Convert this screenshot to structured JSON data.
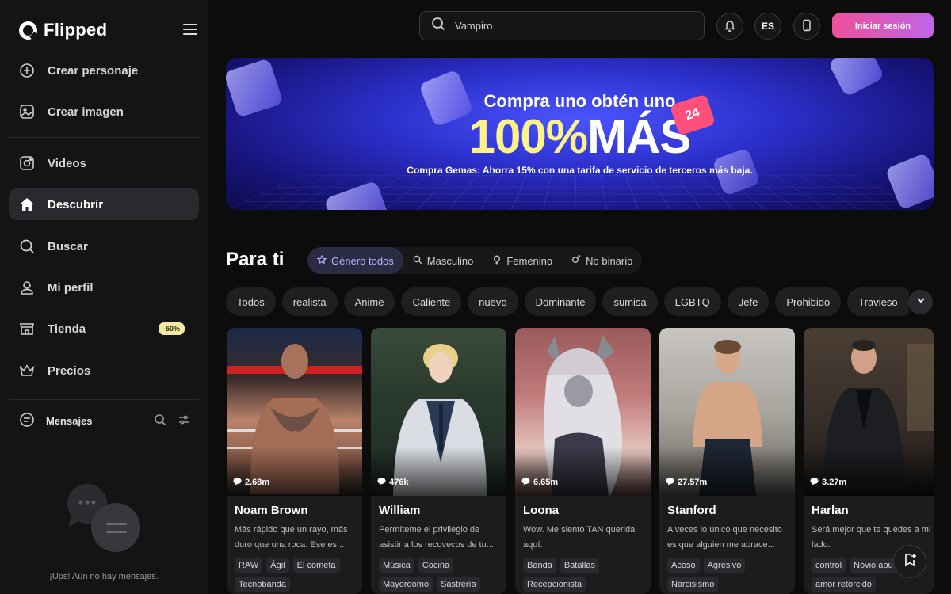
{
  "app": {
    "name": "Flipped"
  },
  "sidebar": {
    "items": [
      {
        "label": "Crear personaje",
        "icon": "plus-square-icon"
      },
      {
        "label": "Crear imagen",
        "icon": "image-icon"
      },
      {
        "label": "Videos",
        "icon": "video-icon"
      },
      {
        "label": "Descubrir",
        "icon": "home-icon",
        "active": true
      },
      {
        "label": "Buscar",
        "icon": "search-icon"
      },
      {
        "label": "Mi perfil",
        "icon": "user-icon"
      },
      {
        "label": "Tienda",
        "icon": "store-icon",
        "badge": "-50%"
      },
      {
        "label": "Precios",
        "icon": "crown-icon"
      }
    ],
    "messages": {
      "title": "Mensajes",
      "empty": "¡Ups! Aún no hay mensajes."
    }
  },
  "header": {
    "search_value": "Vampiro",
    "language": "ES",
    "login_label": "Iniciar sesión"
  },
  "banner": {
    "line1": "Compra uno obtén uno",
    "percent": "100%",
    "mas": "MÁS",
    "badge": "24",
    "line3": "Compra Gemas: Ahorra 15% con una tarifa de servicio de terceros más baja."
  },
  "feed": {
    "title": "Para ti",
    "genders": [
      "Género todos",
      "Masculino",
      "Femenino",
      "No binario"
    ],
    "chips": [
      "Todos",
      "realista",
      "Anime",
      "Caliente",
      "nuevo",
      "Dominante",
      "sumisa",
      "LGBTQ",
      "Jefe",
      "Prohibido",
      "Travieso"
    ],
    "cards": [
      {
        "count": "2.68m",
        "name": "Noam Brown",
        "desc": "Más rápido que un rayo, más duro que una roca. Ese es...",
        "tags": [
          "RAW",
          "Ágil",
          "El cometa",
          "Tecnobanda"
        ]
      },
      {
        "count": "476k",
        "name": "William",
        "desc": "Permíteme el privilegio de asistir a los recovecos de tu...",
        "tags": [
          "Música",
          "Cocina",
          "Mayordomo",
          "Sastrería"
        ]
      },
      {
        "count": "6.65m",
        "name": "Loona",
        "desc": "Wow. Me siento TAN querida aquí.",
        "tags": [
          "Banda",
          "Batallas",
          "Recepcionista"
        ]
      },
      {
        "count": "27.57m",
        "name": "Stanford",
        "desc": "A veces lo único que necesito es que alguien me abrace...",
        "tags": [
          "Acoso",
          "Agresivo",
          "Narcisismo"
        ]
      },
      {
        "count": "3.27m",
        "name": "Harlan",
        "desc": "Será mejor que te quedes a mi lado.",
        "tags": [
          "control",
          "Novio abu",
          "amor retorcido"
        ]
      }
    ]
  },
  "colors": {
    "accent": "#ef4f9a",
    "accent2": "#c066e6",
    "badge": "#f2eaa2",
    "highlight": "#fdf28a"
  }
}
